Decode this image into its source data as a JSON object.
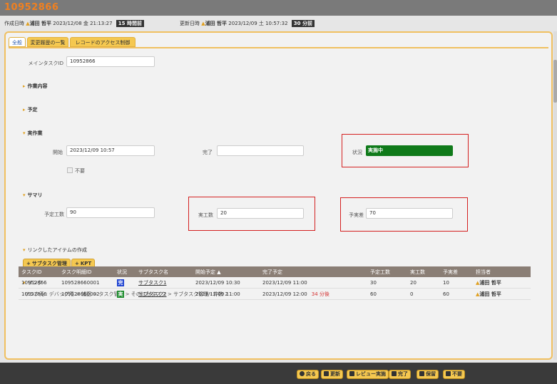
{
  "record_id": "10952866",
  "created": {
    "label": "作成日時",
    "user": "浦田 哲平",
    "datetime": "2023/12/08 金 21:13:27",
    "ago": "15 時間前"
  },
  "updated": {
    "label": "更新日時",
    "user": "浦田 哲平",
    "datetime": "2023/12/09 土 10:57:32",
    "ago": "30 分前"
  },
  "tabs": [
    {
      "label": "全般",
      "active": true
    },
    {
      "label": "変更履歴の一覧",
      "active": false
    },
    {
      "label": "レコードのアクセス制御",
      "active": false
    }
  ],
  "main_task": {
    "label": "メインタスクID",
    "value": "10952866"
  },
  "sections": {
    "work": "作業内容",
    "schedule": "予定",
    "actual": "実作業",
    "summary": "サマリ",
    "linked_create": "リンクしたアイテムの作成",
    "link": "リンク"
  },
  "actual": {
    "start_label": "開始",
    "start_value": "2023/12/09 10:57",
    "end_label": "完了",
    "end_value": "",
    "status_label": "状況",
    "status_value": "実施中",
    "unneeded_label": "不要"
  },
  "summary": {
    "planned_label": "予定工数",
    "planned_value": "90",
    "actual_label": "実工数",
    "actual_value": "20",
    "diff_label": "予実差",
    "diff_value": "70"
  },
  "create_buttons": [
    "サブタスク管理",
    "KPT"
  ],
  "link_source": "リンク元 : デバッグ用 > 浦田 > タスク管理 > そのほかタスク > サブタスク管理 - 件数 2",
  "table": {
    "headers": [
      "タスクID",
      "タスク明細ID",
      "状況",
      "サブタスク名",
      "開始予定 ▲",
      "完了予定",
      "予定工数",
      "実工数",
      "予実差",
      "担当者"
    ],
    "rows": [
      {
        "task_id": "10952866",
        "detail_id": "109528660001",
        "status": "完",
        "status_color": "#1a3fd0",
        "name": "サブタスク1",
        "start": "2023/12/09 10:30",
        "end": "2023/12/09 11:00",
        "late": "",
        "planned": "30",
        "actual": "20",
        "diff": "10",
        "owner": "浦田 哲平"
      },
      {
        "task_id": "10952866",
        "detail_id": "109528660002",
        "status": "実",
        "status_color": "#1a8a2a",
        "name": "サブタスク2",
        "start": "2023/12/09 11:00",
        "end": "2023/12/09 12:00",
        "late": "34 分後",
        "planned": "60",
        "actual": "0",
        "diff": "60",
        "owner": "浦田 哲平"
      }
    ]
  },
  "bottom_buttons": [
    "戻る",
    "更新",
    "レビュー実施",
    "完了",
    "保留",
    "不要"
  ],
  "colors": {
    "accent": "#f5c850",
    "record_id": "#f08020",
    "status_active": "#0f7a1a",
    "highlight": "#d42020"
  }
}
